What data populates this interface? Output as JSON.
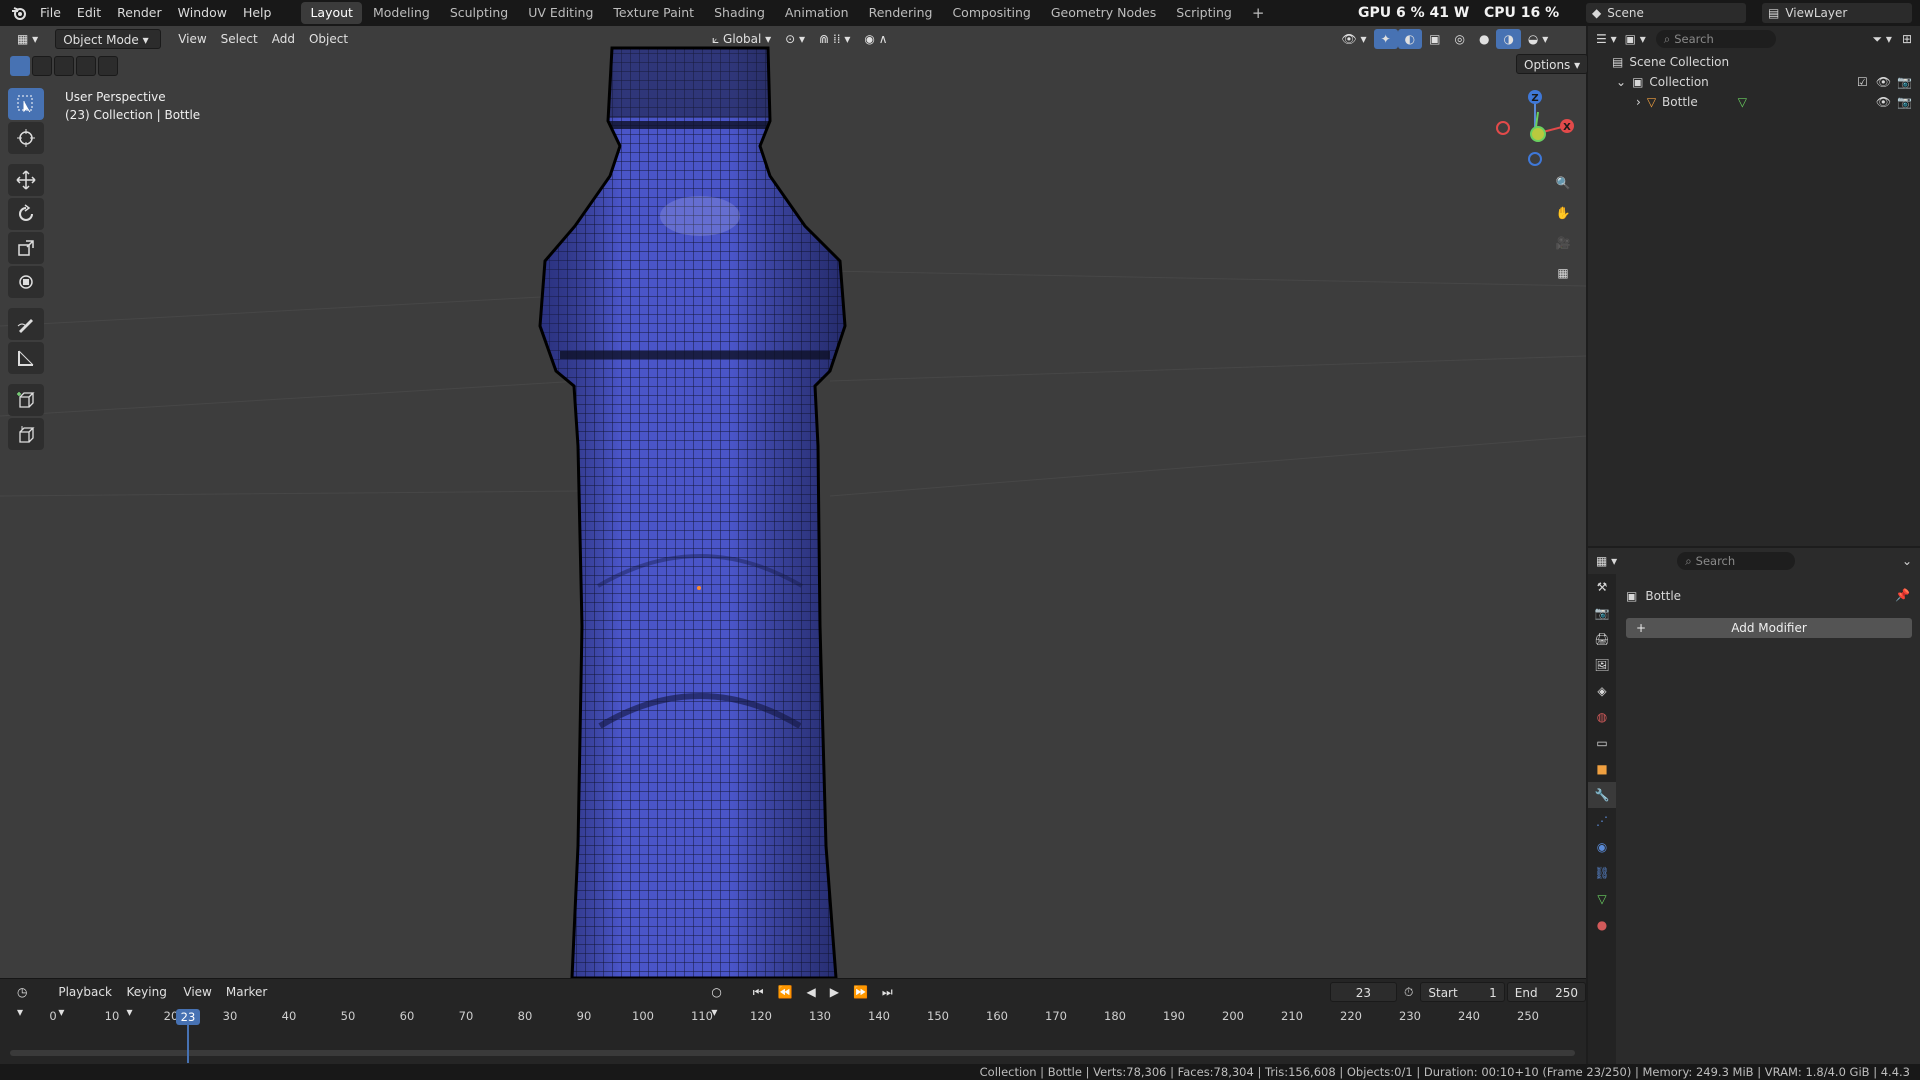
{
  "menu": {
    "items": [
      "File",
      "Edit",
      "Render",
      "Window",
      "Help"
    ]
  },
  "workspaces": {
    "tabs": [
      "Layout",
      "Modeling",
      "Sculpting",
      "UV Editing",
      "Texture Paint",
      "Shading",
      "Animation",
      "Rendering",
      "Compositing",
      "Geometry Nodes",
      "Scripting"
    ],
    "active": "Layout"
  },
  "hud": {
    "gpu": "GPU  6 %  41 W",
    "cpu": "CPU  16 %"
  },
  "scene": {
    "name": "Scene",
    "view_layer": "ViewLayer"
  },
  "viewport": {
    "mode": "Object Mode",
    "menus": [
      "View",
      "Select",
      "Add",
      "Object"
    ],
    "orientation": "Global",
    "options_label": "Options",
    "perspective": "User Perspective",
    "context": "(23) Collection | Bottle",
    "mesh_color": "#4a55c8"
  },
  "outliner": {
    "search_placeholder": "Search",
    "scene_collection": "Scene Collection",
    "collection": "Collection",
    "object": "Bottle"
  },
  "properties": {
    "search_placeholder": "Search",
    "object_name": "Bottle",
    "add_modifier": "Add Modifier"
  },
  "timeline": {
    "menus": [
      "Playback",
      "Keying",
      "View",
      "Marker"
    ],
    "current_frame": "23",
    "start_label": "Start",
    "start": "1",
    "end_label": "End",
    "end": "250",
    "ticks": [
      "0",
      "10",
      "20",
      "30",
      "40",
      "50",
      "60",
      "70",
      "80",
      "90",
      "100",
      "110",
      "120",
      "130",
      "140",
      "150",
      "160",
      "170",
      "180",
      "190",
      "200",
      "210",
      "220",
      "230",
      "240",
      "250"
    ]
  },
  "status": {
    "text": "Collection | Bottle | Verts:78,306 | Faces:78,304 | Tris:156,608 | Objects:0/1 | Duration: 00:10+10 (Frame 23/250) | Memory: 249.3 MiB | VRAM: 1.8/4.0 GiB | 4.4.3"
  }
}
